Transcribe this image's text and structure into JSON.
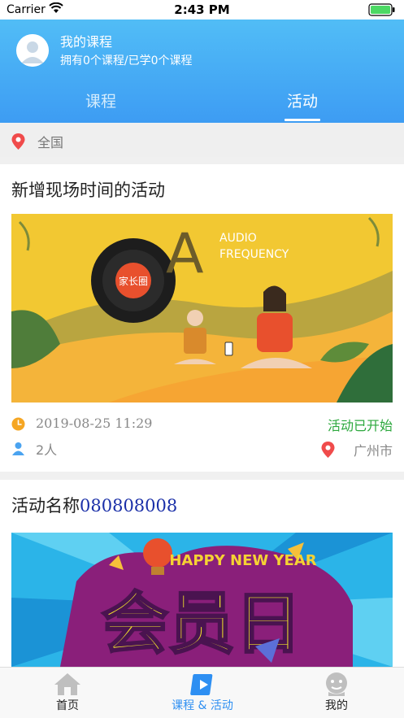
{
  "status_bar": {
    "carrier": "Carrier",
    "time": "2:43 PM"
  },
  "header": {
    "title": "我的课程",
    "subtitle": "拥有0个课程/已学0个课程",
    "tabs": [
      {
        "label": "课程",
        "active": false
      },
      {
        "label": "活动",
        "active": true
      }
    ]
  },
  "location_filter": {
    "label": "全国",
    "icon": "location-pin-icon"
  },
  "activities": [
    {
      "title": "新增现场时间的活动",
      "image_text": {
        "letter": "A",
        "line1": "AUDIO",
        "line2": "FREQUENCY",
        "record_label": "家长圈"
      },
      "datetime": "2019-08-25 11:29",
      "status": "活动已开始",
      "people": "2人",
      "city": "广州市"
    },
    {
      "title_prefix": "活动名称",
      "title_number": "080808008",
      "image_text": {
        "banner": "HAPPY NEW YEAR",
        "main": "会员日"
      }
    }
  ],
  "tabbar": [
    {
      "label": "首页",
      "icon": "home-icon",
      "active": false
    },
    {
      "label": "课程 & 活动",
      "icon": "play-course-icon",
      "active": true
    },
    {
      "label": "我的",
      "icon": "profile-face-icon",
      "active": false
    }
  ],
  "colors": {
    "header_top": "#55c3f7",
    "header_bottom": "#3d9cf3",
    "status_started": "#2ca83d",
    "accent_active": "#2e8ff2",
    "number_text": "#1a2fa8",
    "icon_orange": "#f5a623",
    "icon_blue": "#4aa3f0",
    "icon_red": "#f04b4b"
  }
}
